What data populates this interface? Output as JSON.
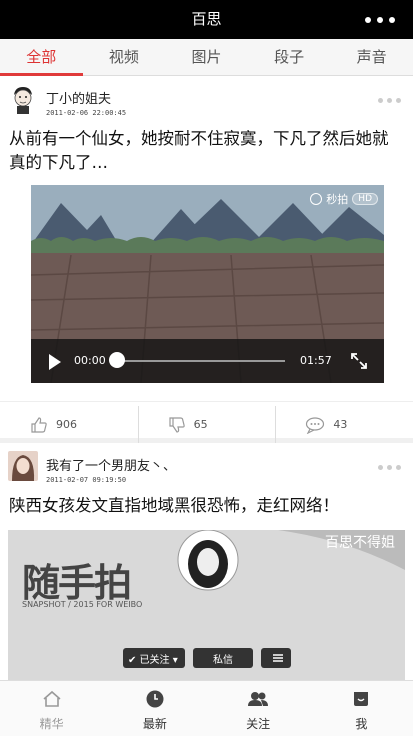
{
  "header": {
    "title": "百思"
  },
  "tabs": [
    "全部",
    "视频",
    "图片",
    "段子",
    "声音"
  ],
  "posts": [
    {
      "username": "丁小的姐夫",
      "time": "2011-02-06 22:00:45",
      "text": "从前有一个仙女，她按耐不住寂寞，下凡了然后她就真的下凡了…",
      "video": {
        "brand": "秒拍",
        "hd": "HD",
        "current": "00:00",
        "duration": "01:57",
        "progress": 0
      },
      "likes": "906",
      "dislikes": "65",
      "comments": "43"
    },
    {
      "username": "我有了一个男朋友丶、",
      "time": "2011-02-07 09:19:50",
      "text": "陕西女孩发文直指地域黑很恐怖，走红网络！",
      "image": {
        "watermark": "百思不得姐",
        "logo": "随手拍",
        "logo_sub": "SNAPSHOT / 2015 FOR WEIBO",
        "follow": "✔ 已关注 ▾",
        "message": "私信"
      }
    }
  ],
  "bottom_nav": [
    {
      "label": "精华",
      "icon": "home-icon"
    },
    {
      "label": "最新",
      "icon": "clock-icon"
    },
    {
      "label": "关注",
      "icon": "people-icon"
    },
    {
      "label": "我",
      "icon": "profile-icon"
    }
  ]
}
